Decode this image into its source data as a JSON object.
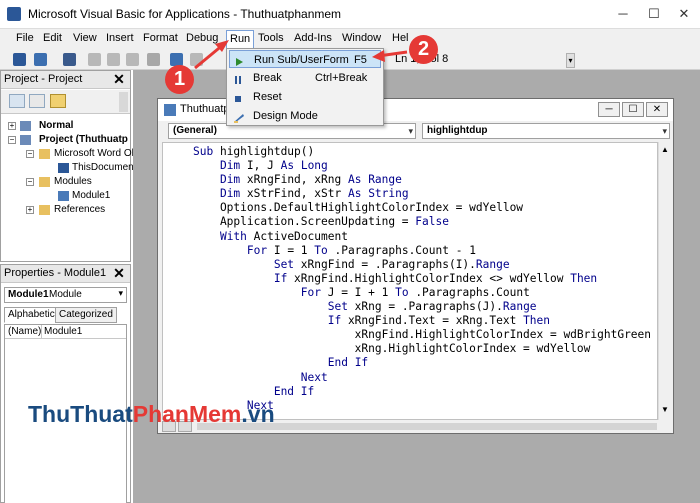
{
  "window": {
    "title": "Microsoft Visual Basic for Applications - Thuthuatphanmem",
    "minimize_glyph": "─",
    "maximize_glyph": "☐",
    "close_glyph": "✕"
  },
  "menubar": {
    "items": [
      "File",
      "Edit",
      "View",
      "Insert",
      "Format",
      "Debug",
      "Run",
      "Tools",
      "Add-Ins",
      "Window",
      "Hel"
    ]
  },
  "toolbar": {
    "position_text": "Ln 1, Col 8"
  },
  "run_menu": {
    "items": [
      {
        "label": "Run Sub/UserForm",
        "shortcut": "F5",
        "icon": "play-icon"
      },
      {
        "label": "Break",
        "shortcut": "Ctrl+Break",
        "icon": "pause-icon"
      },
      {
        "label": "Reset",
        "shortcut": "",
        "icon": "stop-icon"
      },
      {
        "label": "Design Mode",
        "shortcut": "",
        "icon": "design-mode-icon"
      }
    ]
  },
  "project_panel": {
    "title": "Project - Project",
    "tree": [
      {
        "label": "Normal",
        "bold": true
      },
      {
        "label": "Project (Thuthuatp",
        "bold": true
      },
      {
        "label": "Microsoft Word Ol",
        "bold": false
      },
      {
        "label": "ThisDocument",
        "bold": false
      },
      {
        "label": "Modules",
        "bold": false
      },
      {
        "label": "Module1",
        "bold": false
      },
      {
        "label": "References",
        "bold": false
      }
    ]
  },
  "properties_panel": {
    "title": "Properties - Module1",
    "object_name": "Module1",
    "object_type": "Module",
    "tabs": [
      "Alphabetic",
      "Categorized"
    ],
    "row_name": "(Name)",
    "row_value": "Module1"
  },
  "code_window": {
    "title": "Thuthuatp",
    "object_combo": "(General)",
    "proc_combo": "highlightdup",
    "lines": [
      "Sub highlightdup()",
      "    Dim I, J As Long",
      "    Dim xRngFind, xRng As Range",
      "    Dim xStrFind, xStr As String",
      "    Options.DefaultHighlightColorIndex = wdYellow",
      "    Application.ScreenUpdating = False",
      "    With ActiveDocument",
      "        For I = 1 To .Paragraphs.Count - 1",
      "            Set xRngFind = .Paragraphs(I).Range",
      "            If xRngFind.HighlightColorIndex <> wdYellow Then",
      "                For J = I + 1 To .Paragraphs.Count",
      "                    Set xRng = .Paragraphs(J).Range",
      "                    If xRngFind.Text = xRng.Text Then",
      "                        xRngFind.HighlightColorIndex = wdBrightGreen",
      "                        xRng.HighlightColorIndex = wdYellow",
      "                    End If",
      "                Next",
      "            End If",
      "        Next"
    ]
  },
  "annotations": {
    "step1": "1",
    "step2": "2"
  },
  "watermark": {
    "part1": "ThuThuat",
    "part2": "PhanMem",
    "part3": ".vn"
  },
  "colors": {
    "accent": "#7aa0d8",
    "badge": "#e53935",
    "keyword": "#00008b",
    "watermark_dark": "#1a4b7f"
  }
}
